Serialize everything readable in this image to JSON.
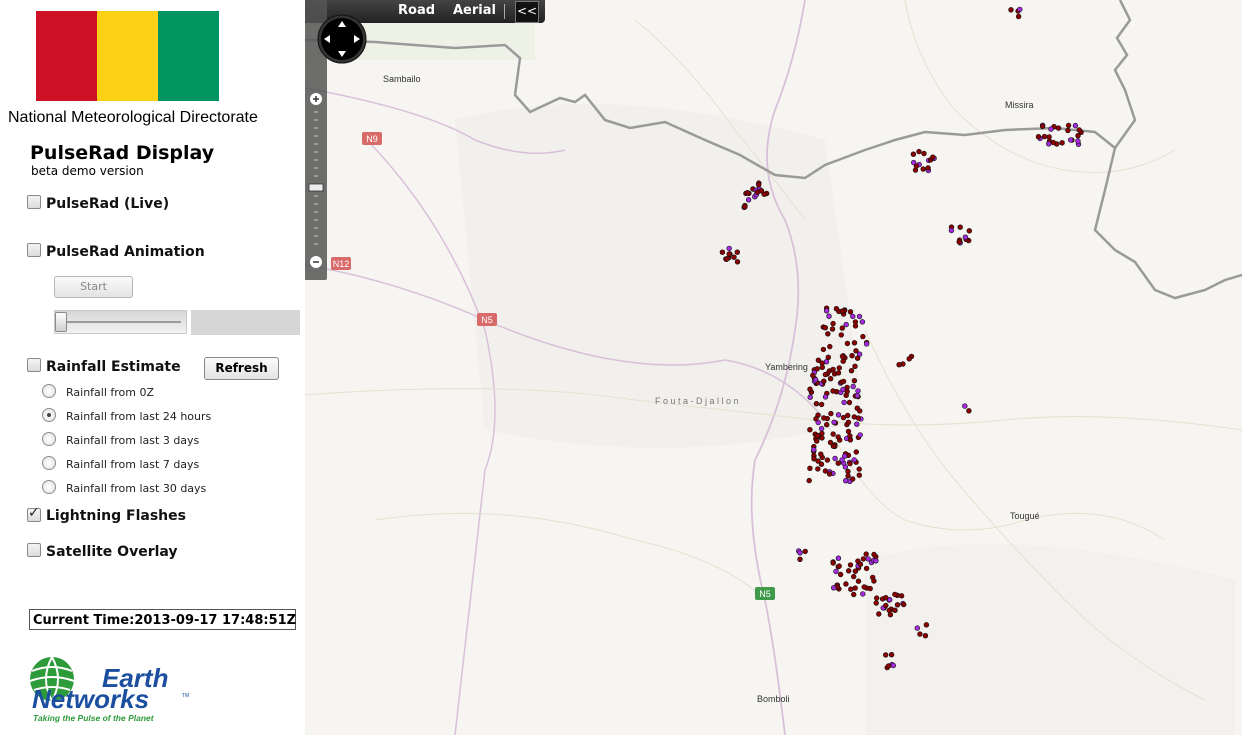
{
  "org": "National Meteorological Directorate",
  "flag_colors": [
    "#CE1126",
    "#FCD116",
    "#009460"
  ],
  "app": {
    "title": "PulseRad Display",
    "subtitle": "beta demo version"
  },
  "options": {
    "live": {
      "label": "PulseRad (Live)",
      "checked": false
    },
    "animation": {
      "label": "PulseRad Animation",
      "checked": false,
      "start_label": "Start",
      "slider_value": 0
    },
    "rainfall": {
      "label": "Rainfall Estimate",
      "checked": false,
      "refresh_label": "Refresh"
    },
    "lightning": {
      "label": "Lightning Flashes",
      "checked": true
    },
    "satellite": {
      "label": "Satellite Overlay",
      "checked": false
    }
  },
  "rain_options": [
    {
      "label": "Rainfall from 0Z",
      "selected": false
    },
    {
      "label": "Rainfall from last 24 hours",
      "selected": true
    },
    {
      "label": "Rainfall from last 3 days",
      "selected": false
    },
    {
      "label": "Rainfall from last 7 days",
      "selected": false
    },
    {
      "label": "Rainfall from last 30 days",
      "selected": false
    }
  ],
  "current_time": "Current Time:2013-09-17 17:48:51Z",
  "logo": {
    "line1": "Earth",
    "line2": "Networks",
    "tagline": "Taking the Pulse of the Planet",
    "tm": "TM",
    "brand_blue": "#1c4fa0",
    "brand_green": "#2e9b3a"
  },
  "map": {
    "modes": {
      "road": "Road",
      "aerial": "Aerial",
      "collapse": "<<"
    },
    "places": {
      "sambailo": "Sambailo",
      "missira": "Missira",
      "yambering": "Yambering",
      "fouta": "F o u t a - D j a l l o n",
      "tougue": "Tougué",
      "bomboli": "Bomboli"
    },
    "road_labels": {
      "n9": "N9",
      "n12": "N12",
      "n5a": "N5",
      "n5b": "N5"
    },
    "colors": {
      "background": "#f6f5f1",
      "border": "#9a9a9a",
      "road": "#d9c0da",
      "road_red": "#d96a6a",
      "road_green": "#3f9a4a",
      "lightning": "#8b0000",
      "lightning_recent": "#a52be0"
    }
  }
}
